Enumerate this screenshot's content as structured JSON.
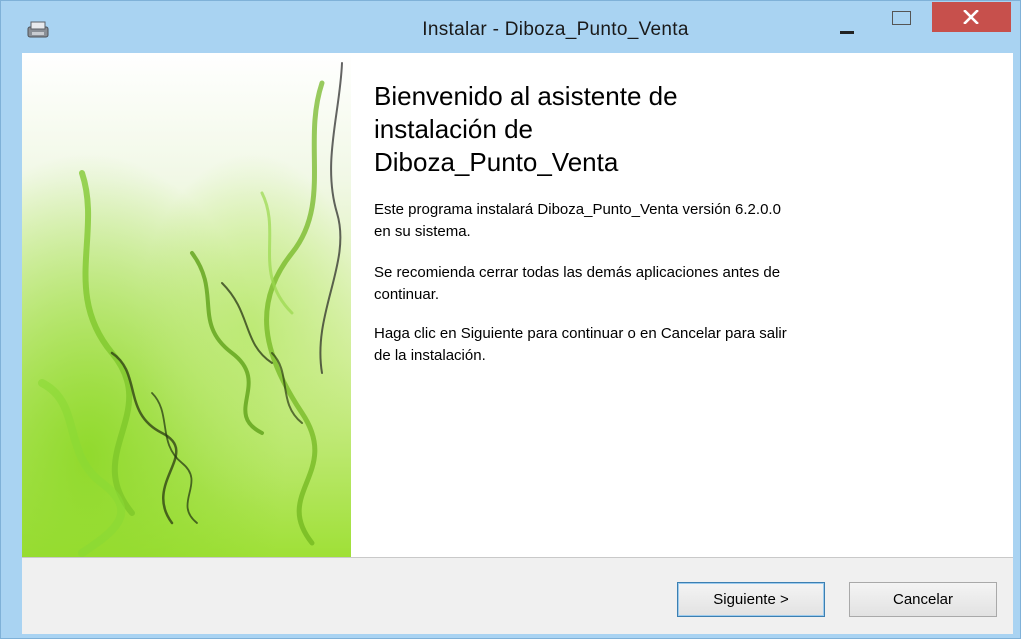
{
  "window": {
    "title": "Instalar - Diboza_Punto_Venta",
    "controls": {
      "minimize_icon": "minimize-icon",
      "maximize_icon": "maximize-icon",
      "close_icon": "close-icon"
    },
    "colors": {
      "frame": "#a9d3f2",
      "close_button": "#c7504c",
      "footer": "#f0f0f0",
      "button_focus_border": "#3c7fb1"
    }
  },
  "wizard": {
    "heading": "Bienvenido al asistente de\ninstalación de\nDiboza_Punto_Venta",
    "paragraphs": [
      "Este programa instalará Diboza_Punto_Venta versión 6.2.0.0\nen su sistema.",
      "Se recomienda cerrar todas las demás aplicaciones antes de\ncontinuar.",
      "Haga clic en Siguiente para continuar o en Cancelar para salir\nde la instalación."
    ],
    "side_image": "green-smoke-image"
  },
  "footer": {
    "next_label": "Siguiente >",
    "cancel_label": "Cancelar"
  }
}
